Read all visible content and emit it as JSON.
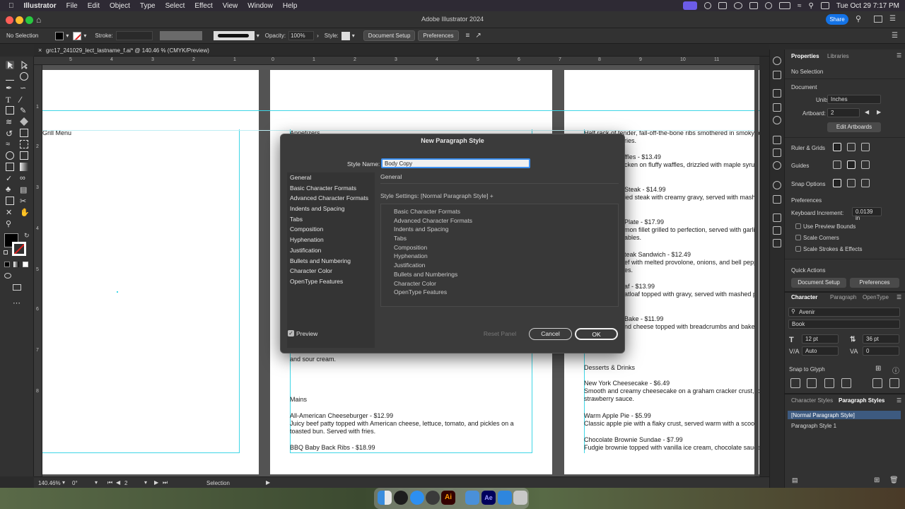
{
  "menubar": {
    "apple": "",
    "app": "Illustrator",
    "items": [
      "File",
      "Edit",
      "Object",
      "Type",
      "Select",
      "Effect",
      "View",
      "Window",
      "Help"
    ],
    "datetime": "Tue Oct 29  7:17 PM"
  },
  "titlebar": {
    "title": "Adobe Illustrator 2024",
    "share": "Share"
  },
  "control": {
    "selection": "No Selection",
    "stroke_label": "Stroke:",
    "opacity_label": "Opacity:",
    "opacity_value": "100%",
    "style_label": "Style:",
    "document_setup": "Document Setup",
    "preferences": "Preferences"
  },
  "doc_tab": {
    "close": "×",
    "name": "grc17_241029_lect_lastname_f.ai* @ 140.46 % (CMYK/Preview)"
  },
  "rulers": {
    "top": [
      "5",
      "4",
      "3",
      "2",
      "1",
      "0",
      "1",
      "2",
      "3",
      "4",
      "5",
      "6",
      "7",
      "8",
      "9",
      "10",
      "11"
    ],
    "left": [
      "1",
      "2",
      "3",
      "4",
      "5",
      "6",
      "7",
      "8"
    ]
  },
  "artboard_left": {
    "heading": "Grill Menu"
  },
  "artboard_mid": {
    "top_heading": "Appetizers",
    "lines": [
      "and sour cream.",
      "Mains",
      "All-American Cheeseburger - $12.99",
      "Juicy beef patty topped with American cheese, lettuce, tomato, and pickles on a",
      "toasted bun. Served with fries.",
      "BBQ Baby Back Ribs - $18.99"
    ]
  },
  "artboard_right": {
    "lines": [
      "Half rack of tender, fall-off-the-bone ribs smothered in smoky b",
      "ries.",
      "ffles - $13.49",
      "cken on fluffy waffles, drizzled with maple syrup",
      "Steak - $14.99",
      "ied steak with creamy gravy, served with mashe",
      "Plate - $17.99",
      "mon fillet grilled to perfection, served with garlic",
      "ables.",
      "teak Sandwich - $12.49",
      "ef with melted provolone, onions, and bell pepp",
      "es.",
      "af - $13.99",
      "atloaf topped with gravy, served with mashed p",
      "Bake - $11.99",
      "nd cheese topped with breadcrumbs and baked",
      "Desserts & Drinks",
      "New York Cheesecake - $6.49",
      "Smooth and creamy cheesecake on a graham cracker crust, top",
      "strawberry sauce.",
      "Warm Apple Pie - $5.99",
      "Classic apple pie with a flaky crust, served warm with a scoop c",
      "Chocolate Brownie Sundae - $7.99",
      "Fudgie brownie topped with vanilla ice cream, chocolate sauce"
    ]
  },
  "dialog": {
    "title": "New Paragraph Style",
    "style_name_label": "Style Name:",
    "style_name_value": "Body Copy",
    "sections": [
      "General",
      "Basic Character Formats",
      "Advanced Character Formats",
      "Indents and Spacing",
      "Tabs",
      "Composition",
      "Hyphenation",
      "Justification",
      "Bullets and Numbering",
      "Character Color",
      "OpenType Features"
    ],
    "pane_title": "General",
    "settings_label": "Style Settings:",
    "settings_value": "[Normal Paragraph Style] +",
    "settings_items": [
      "Basic Character Formats",
      "Advanced Character Formats",
      "Indents and Spacing",
      "Tabs",
      "Composition",
      "Hyphenation",
      "Justification",
      "Bullets and Numberings",
      "Character Color",
      "OpenType Features"
    ],
    "preview": "Preview",
    "reset": "Reset Panel",
    "cancel": "Cancel",
    "ok": "OK"
  },
  "status": {
    "zoom": "140.46%",
    "angle": "0°",
    "artboard": "2",
    "tool": "Selection"
  },
  "right_panel": {
    "tabs": [
      "Properties",
      "Libraries"
    ],
    "no_selection": "No Selection",
    "document": "Document",
    "units_label": "Units:",
    "units_value": "Inches",
    "artboard_label": "Artboard:",
    "artboard_value": "2",
    "edit_artboards": "Edit Artboards",
    "ruler_grids": "Ruler & Grids",
    "guides": "Guides",
    "snap_options": "Snap Options",
    "preferences": "Preferences",
    "keyboard_increment_label": "Keyboard Increment:",
    "keyboard_increment_value": "0.0139 in",
    "use_preview_bounds": "Use Preview Bounds",
    "scale_corners": "Scale Corners",
    "scale_strokes": "Scale Strokes & Effects",
    "quick_actions": "Quick Actions",
    "qa_document_setup": "Document Setup",
    "qa_preferences": "Preferences",
    "char_tabs": [
      "Character",
      "Paragraph",
      "OpenType"
    ],
    "font_family": "Avenir",
    "font_style": "Book",
    "font_size": "12 pt",
    "leading": "36 pt",
    "kerning": "Auto",
    "tracking": "0",
    "snap_to_glyph": "Snap to Glyph",
    "style_tabs": [
      "Character Styles",
      "Paragraph Styles"
    ],
    "styles": [
      "[Normal Paragraph Style]",
      "Paragraph Style 1"
    ]
  }
}
